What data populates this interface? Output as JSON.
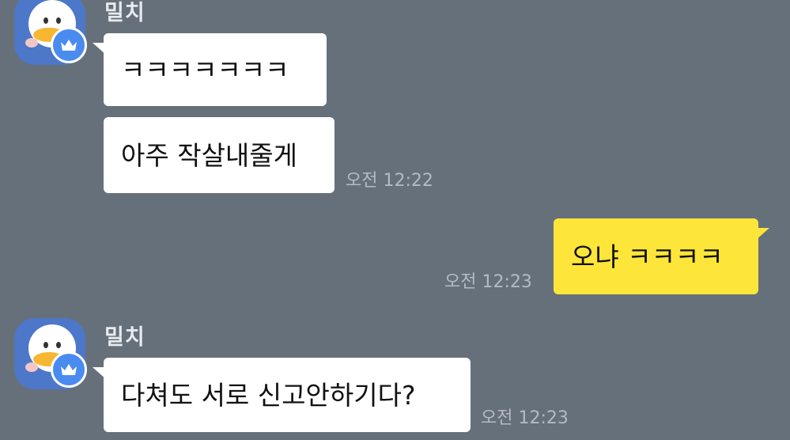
{
  "chat": {
    "messages": [
      {
        "sender": "밀치",
        "text": "ㅋㅋㅋㅋㅋㅋㅋ"
      },
      {
        "text": "아주 작살내줄게",
        "time": "오전 12:22"
      },
      {
        "text": "오냐 ㅋㅋㅋㅋ",
        "time": "오전 12:23"
      },
      {
        "sender": "밀치",
        "text": "다쳐도 서로 신고안하기다?",
        "time": "오전 12:23"
      }
    ]
  },
  "colors": {
    "background": "#66707b",
    "incoming_bubble": "#ffffff",
    "outgoing_bubble": "#fde53a",
    "avatar_bg": "#4d77c9",
    "badge": "#4a8bf0"
  },
  "icons": {
    "avatar": "duck-character-avatar",
    "badge": "crown-icon"
  }
}
